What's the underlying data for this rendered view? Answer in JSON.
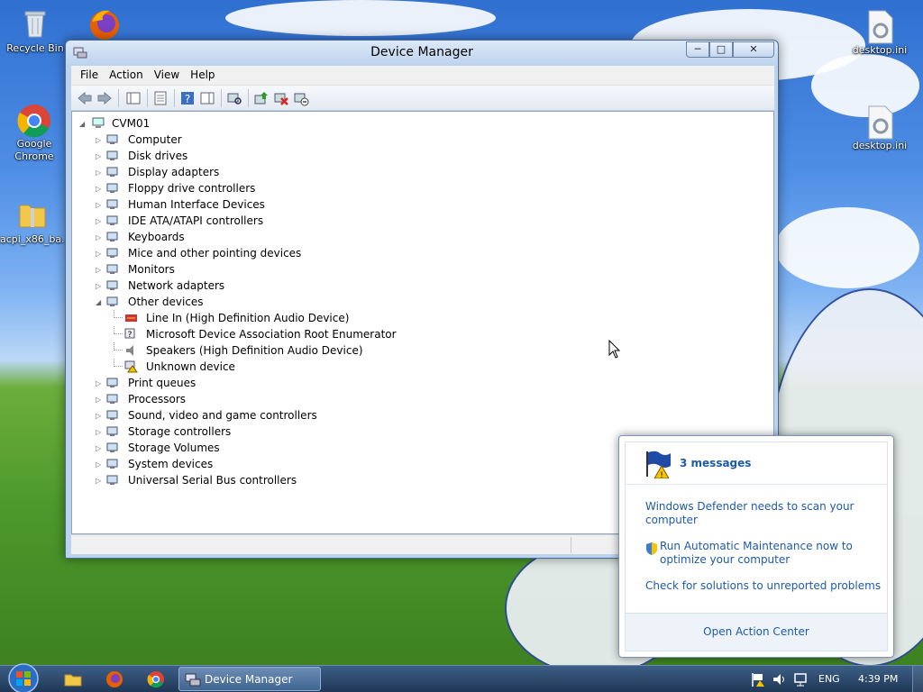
{
  "window": {
    "title": "Device Manager",
    "controls": {
      "minimize": "─",
      "maximize": "□",
      "close": "✕"
    }
  },
  "menu": [
    "File",
    "Action",
    "View",
    "Help"
  ],
  "toolbar": [
    "back-icon",
    "forward-icon",
    "show-hide-console-tree-icon",
    "properties-icon",
    "help-icon",
    "action-pane-icon",
    "scan-hardware-icon",
    "update-driver-icon",
    "uninstall-icon",
    "disable-icon"
  ],
  "desktop": {
    "icons": [
      "Recycle Bin",
      "Google Chrome",
      "acpi_x86_ba...",
      "desktop.ini",
      "desktop.ini"
    ]
  },
  "tree": {
    "root": "CVM01",
    "categories": [
      {
        "label": "Computer",
        "icon": "computer-icon"
      },
      {
        "label": "Disk drives",
        "icon": "disk-drive-icon"
      },
      {
        "label": "Display adapters",
        "icon": "display-adapter-icon"
      },
      {
        "label": "Floppy drive controllers",
        "icon": "floppy-controller-icon"
      },
      {
        "label": "Human Interface Devices",
        "icon": "hid-icon"
      },
      {
        "label": "IDE ATA/ATAPI controllers",
        "icon": "ide-controller-icon"
      },
      {
        "label": "Keyboards",
        "icon": "keyboard-icon"
      },
      {
        "label": "Mice and other pointing devices",
        "icon": "mouse-icon"
      },
      {
        "label": "Monitors",
        "icon": "monitor-icon"
      },
      {
        "label": "Network adapters",
        "icon": "network-adapter-icon"
      },
      {
        "label": "Other devices",
        "icon": "other-devices-icon",
        "expanded": true,
        "children": [
          {
            "label": "Line In (High Definition Audio Device)",
            "icon": "line-in-icon"
          },
          {
            "label": "Microsoft Device Association Root Enumerator",
            "icon": "unknown-device-icon"
          },
          {
            "label": "Speakers (High Definition Audio Device)",
            "icon": "speaker-icon"
          },
          {
            "label": "Unknown device",
            "icon": "warning-device-icon"
          }
        ]
      },
      {
        "label": "Print queues",
        "icon": "printer-icon"
      },
      {
        "label": "Processors",
        "icon": "processor-icon"
      },
      {
        "label": "Sound, video and game controllers",
        "icon": "sound-icon"
      },
      {
        "label": "Storage controllers",
        "icon": "storage-controller-icon"
      },
      {
        "label": "Storage Volumes",
        "icon": "storage-volume-icon"
      },
      {
        "label": "System devices",
        "icon": "system-device-icon"
      },
      {
        "label": "Universal Serial Bus controllers",
        "icon": "usb-icon"
      }
    ]
  },
  "popup": {
    "header": "3 messages",
    "items": [
      "Windows Defender needs to scan your computer",
      "Run Automatic Maintenance now to optimize your computer",
      "Check for solutions to unreported problems"
    ],
    "footer": "Open Action Center"
  },
  "taskbar": {
    "active_window": "Device Manager",
    "language": "ENG",
    "time": "4:39 PM"
  },
  "colors": {
    "link": "#1e5aa8",
    "taskbar": "#1f3756",
    "window_frame": "#bcd3ee"
  }
}
